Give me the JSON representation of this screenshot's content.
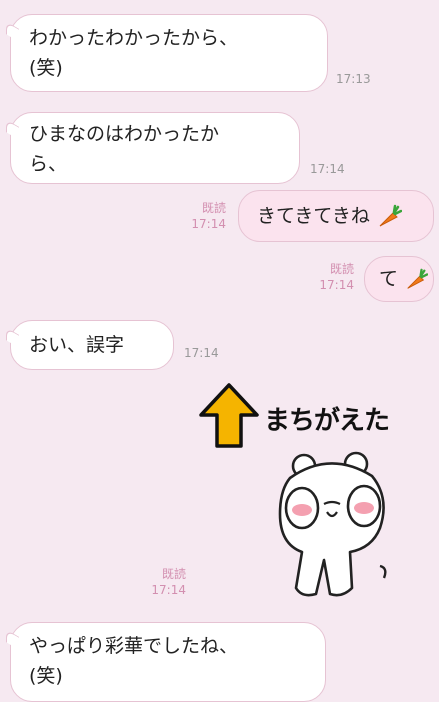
{
  "messages": [
    {
      "lines": [
        "わかったわかったから、",
        "(笑)"
      ],
      "time": "17:13"
    },
    {
      "lines": [
        "ひまなのはわかったか",
        "ら、"
      ],
      "time": "17:14"
    },
    {
      "text": "きてきてきね",
      "read": "既読",
      "time": "17:14"
    },
    {
      "text": "て",
      "read": "既読",
      "time": "17:14"
    },
    {
      "text": "おい、誤字",
      "time": "17:14"
    },
    {
      "read": "既読",
      "time": "17:14"
    },
    {
      "lines": [
        "やっぱり彩華でしたね、",
        "(笑)"
      ]
    }
  ],
  "sticker": {
    "caption": "まちがえた"
  },
  "colors": {
    "background": "#f6e9f1",
    "arrow": "#f5b400",
    "read": "#d38fb0"
  }
}
